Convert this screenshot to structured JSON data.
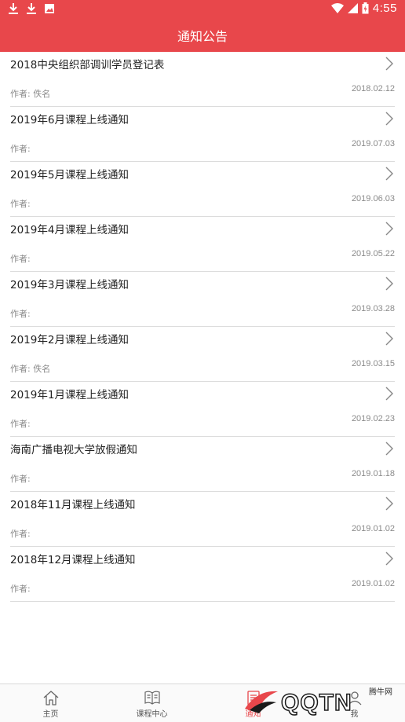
{
  "status_bar": {
    "time": "4:55"
  },
  "header": {
    "title": "通知公告"
  },
  "notices": [
    {
      "title": "2018中央组织部调训学员登记表",
      "author": "作者: 佚名",
      "date": "2018.02.12"
    },
    {
      "title": "2019年6月课程上线通知",
      "author": "作者:",
      "date": "2019.07.03"
    },
    {
      "title": "2019年5月课程上线通知",
      "author": "作者:",
      "date": "2019.06.03"
    },
    {
      "title": "2019年4月课程上线通知",
      "author": "作者:",
      "date": "2019.05.22"
    },
    {
      "title": "2019年3月课程上线通知",
      "author": "作者:",
      "date": "2019.03.28"
    },
    {
      "title": "2019年2月课程上线通知",
      "author": "作者: 佚名",
      "date": "2019.03.15"
    },
    {
      "title": "2019年1月课程上线通知",
      "author": "作者:",
      "date": "2019.02.23"
    },
    {
      "title": "海南广播电视大学放假通知",
      "author": "作者:",
      "date": "2019.01.18"
    },
    {
      "title": "2018年11月课程上线通知",
      "author": "作者:",
      "date": "2019.01.02"
    },
    {
      "title": "2018年12月课程上线通知",
      "author": "作者:",
      "date": "2019.01.02"
    }
  ],
  "tabs": [
    {
      "label": "主页",
      "icon": "home-icon"
    },
    {
      "label": "课程中心",
      "icon": "book-icon"
    },
    {
      "label": "通知",
      "icon": "notice-icon",
      "active": true
    },
    {
      "label": "我",
      "icon": "user-icon"
    }
  ],
  "watermark": {
    "text": "QQTN",
    "cn": "腾牛网"
  },
  "colors": {
    "accent": "#e8474b",
    "divider": "#dcdcdc",
    "secondary_text": "#8a8a8a"
  }
}
